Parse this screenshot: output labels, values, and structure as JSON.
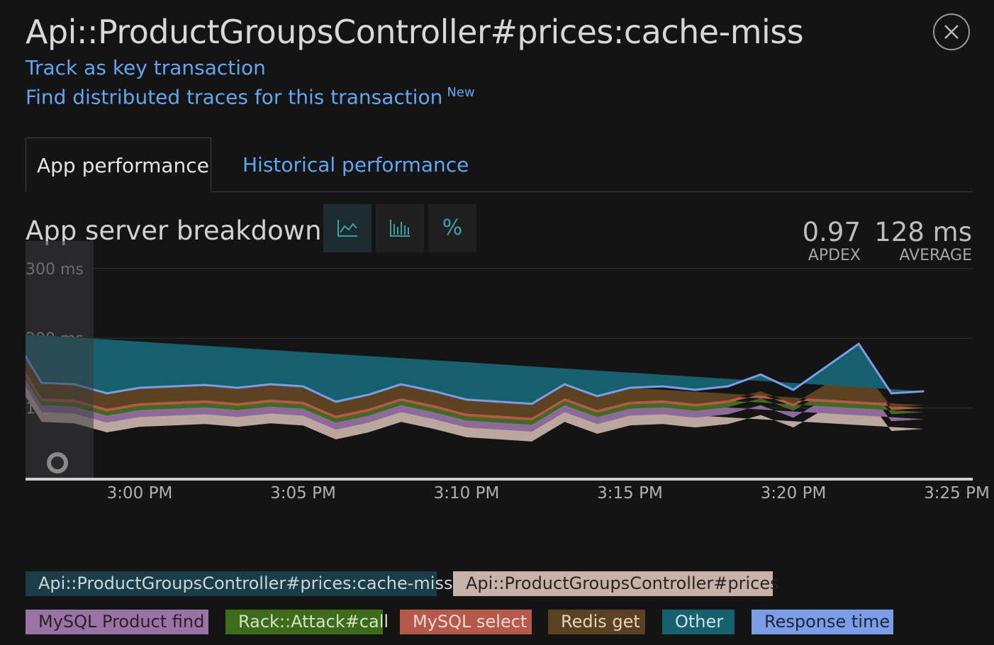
{
  "header": {
    "title": "Api::ProductGroupsController#prices:cache-miss",
    "track_link": "Track as key transaction",
    "traces_link": "Find distributed traces for this transaction",
    "new_badge": "New"
  },
  "tabs": [
    {
      "label": "App performance",
      "active": true
    },
    {
      "label": "Historical performance",
      "active": false
    }
  ],
  "section": {
    "title": "App server breakdown",
    "view_buttons": [
      {
        "icon": "area-chart-icon",
        "active": true
      },
      {
        "icon": "bar-chart-icon",
        "active": false
      },
      {
        "icon": "percent-icon",
        "label": "%",
        "active": false
      }
    ]
  },
  "stats": {
    "apdex_value": "0.97",
    "apdex_label": "APDEX",
    "average_value": "128 ms",
    "average_label": "AVERAGE"
  },
  "colors": {
    "background": "#141414",
    "link": "#5fa7f0",
    "grid": "#333333"
  },
  "chart_data": {
    "type": "area",
    "stacked": true,
    "y_ticks": [
      {
        "value": 100,
        "label": "100 ms"
      },
      {
        "value": 200,
        "label": "200 ms"
      },
      {
        "value": 300,
        "label": "300 ms"
      }
    ],
    "ylim": [
      0,
      300
    ],
    "x_ticks": [
      {
        "minute": 5,
        "label": "3:00 PM"
      },
      {
        "minute": 10,
        "label": "3:05 PM"
      },
      {
        "minute": 15,
        "label": "3:10 PM"
      },
      {
        "minute": 20,
        "label": "3:15 PM"
      },
      {
        "minute": 25,
        "label": "3:20 PM"
      },
      {
        "minute": 30,
        "label": "3:25 PM"
      }
    ],
    "x_minutes": [
      0,
      1,
      2,
      3,
      4,
      5,
      6,
      7,
      8,
      9,
      10,
      11,
      12,
      13,
      14,
      15,
      16,
      17,
      18,
      19,
      20,
      21,
      22,
      23,
      24,
      25,
      26,
      27,
      28,
      29,
      30,
      31,
      32,
      33
    ],
    "series": [
      {
        "name": "Api::ProductGroupsController#prices",
        "color": "#bca79f",
        "values": [
          150,
          155,
          80,
          78,
          65,
          73,
          75,
          77,
          73,
          78,
          75,
          55,
          65,
          80,
          70,
          58,
          55,
          52,
          80,
          63,
          75,
          77,
          72,
          77,
          90,
          72,
          100,
          130,
          67,
          70
        ]
      },
      {
        "name": "MySQL Product find",
        "color": "#8e6a9a",
        "values": [
          14,
          14,
          14,
          14,
          14,
          14,
          14,
          14,
          14,
          14,
          14,
          14,
          14,
          14,
          14,
          14,
          14,
          14,
          14,
          14,
          14,
          14,
          14,
          14,
          14,
          14,
          14,
          14,
          14,
          14
        ]
      },
      {
        "name": "Rack::Attack#call",
        "color": "#3f6a1f",
        "values": [
          10,
          10,
          10,
          10,
          10,
          10,
          10,
          10,
          10,
          10,
          10,
          10,
          10,
          10,
          10,
          10,
          10,
          10,
          10,
          10,
          10,
          10,
          10,
          10,
          10,
          10,
          10,
          10,
          10,
          10
        ]
      },
      {
        "name": "MySQL select",
        "color": "#b4584a",
        "values": [
          6,
          6,
          6,
          6,
          6,
          6,
          6,
          6,
          6,
          6,
          6,
          6,
          6,
          6,
          6,
          6,
          6,
          6,
          6,
          6,
          6,
          6,
          6,
          6,
          6,
          6,
          6,
          6,
          6,
          6
        ]
      },
      {
        "name": "Redis get",
        "color": "#5c4220",
        "values": [
          4,
          4,
          4,
          4,
          4,
          4,
          4,
          4,
          4,
          4,
          4,
          4,
          4,
          4,
          4,
          4,
          4,
          4,
          4,
          4,
          4,
          4,
          4,
          4,
          4,
          4,
          4,
          4,
          4,
          4
        ]
      },
      {
        "name": "Other",
        "color": "#16606e",
        "values": [
          26,
          24,
          22,
          22,
          22,
          22,
          22,
          22,
          22,
          22,
          22,
          20,
          20,
          20,
          20,
          20,
          20,
          20,
          20,
          20,
          20,
          20,
          20,
          20,
          24,
          20,
          25,
          28,
          20,
          20
        ]
      }
    ],
    "response_time": {
      "name": "Response time",
      "color": "#7a9de8",
      "values": [
        210,
        213,
        136,
        134,
        121,
        129,
        131,
        133,
        129,
        134,
        131,
        109,
        119,
        134,
        124,
        112,
        109,
        106,
        134,
        117,
        129,
        131,
        126,
        131,
        148,
        126,
        159,
        192,
        121,
        124
      ]
    },
    "overlay_window": {
      "name": "Api::ProductGroupsController#prices:cache-miss",
      "color": "#3a3a3e"
    },
    "legend": [
      {
        "label": "Api::ProductGroupsController#prices:cache-miss",
        "bg": "#1a3d47",
        "fg": "#c9d6da"
      },
      {
        "label": "Api::ProductGroupsController#prices",
        "bg": "#c7b2aa",
        "fg": "#2a2320"
      },
      {
        "label": "MySQL Product find",
        "bg": "#9a73a5",
        "fg": "#2a1f2e"
      },
      {
        "label": "Rack::Attack#call",
        "bg": "#3d6b1c",
        "fg": "#d2e3c4"
      },
      {
        "label": "MySQL select",
        "bg": "#b5594b",
        "fg": "#f2d7d2"
      },
      {
        "label": "Redis get",
        "bg": "#5a4121",
        "fg": "#e3d4bd"
      },
      {
        "label": "Other",
        "bg": "#17606e",
        "fg": "#cfe3e7"
      },
      {
        "label": "Response time",
        "bg": "#7b9de6",
        "fg": "#1c2440"
      }
    ]
  }
}
